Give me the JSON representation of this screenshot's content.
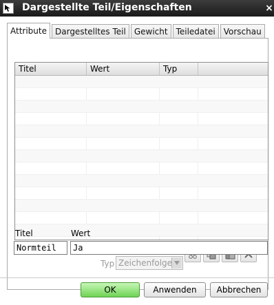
{
  "window": {
    "title": "Dargestellte Teil/Eigenschaften",
    "close": "×"
  },
  "tabs": [
    {
      "label": "Attribute",
      "active": true
    },
    {
      "label": "Dargestelltes Teil",
      "active": false
    },
    {
      "label": "Gewicht",
      "active": false
    },
    {
      "label": "Teiledatei",
      "active": false
    },
    {
      "label": "Vorschau",
      "active": false
    }
  ],
  "table": {
    "columns": [
      "Titel",
      "Wert",
      "Typ"
    ],
    "row_count": 15
  },
  "toolbar": {
    "icons": [
      "cut-icon",
      "copy-icon",
      "paste-icon",
      "delete-icon"
    ]
  },
  "form": {
    "title_label": "Titel",
    "value_label": "Wert",
    "title_value": "Normteil",
    "value_value": "Ja",
    "type_label": "Typ",
    "type_value": "Zeichenfolge"
  },
  "buttons": {
    "ok": "OK",
    "apply": "Anwenden",
    "cancel": "Abbrechen"
  },
  "colors": {
    "ok_button": "#6fd354",
    "titlebar": "#1a1a1a"
  }
}
